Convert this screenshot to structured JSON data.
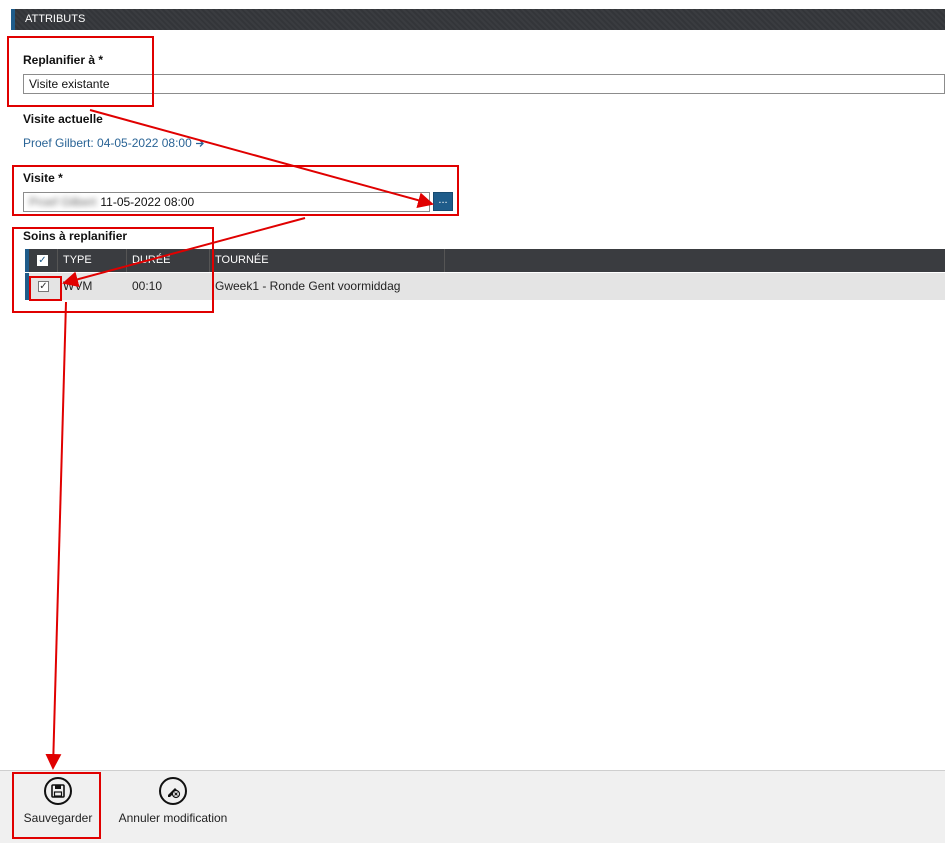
{
  "section": {
    "title": "ATTRIBUTS"
  },
  "replan": {
    "label": "Replanifier à *",
    "value": "Visite existante"
  },
  "current_visit": {
    "label": "Visite actuelle",
    "link": "Proef Gilbert: 04-05-2022 08:00",
    "arrow_icon": "arrow-right-icon"
  },
  "visit": {
    "label": "Visite *",
    "blurred_prefix": "Proef Gilbert",
    "value": "11-05-2022 08:00",
    "lookup_label": "..."
  },
  "care": {
    "label": "Soins à replanifier",
    "columns": [
      "TYPE",
      "DURÉE",
      "TOURNÉE"
    ],
    "rows": [
      {
        "checked": true,
        "type": "WVM",
        "duration": "00:10",
        "round": "Gweek1 - Ronde Gent voormiddag"
      }
    ]
  },
  "actions": {
    "save": {
      "label": "Sauvegarder",
      "icon": "floppy-disk-icon"
    },
    "cancel": {
      "label": "Annuler modification",
      "icon": "cancel-edit-icon"
    }
  },
  "colors": {
    "accent": "#1f5c8a",
    "annotation": "#e00000",
    "header_bg": "#3a3c40"
  }
}
